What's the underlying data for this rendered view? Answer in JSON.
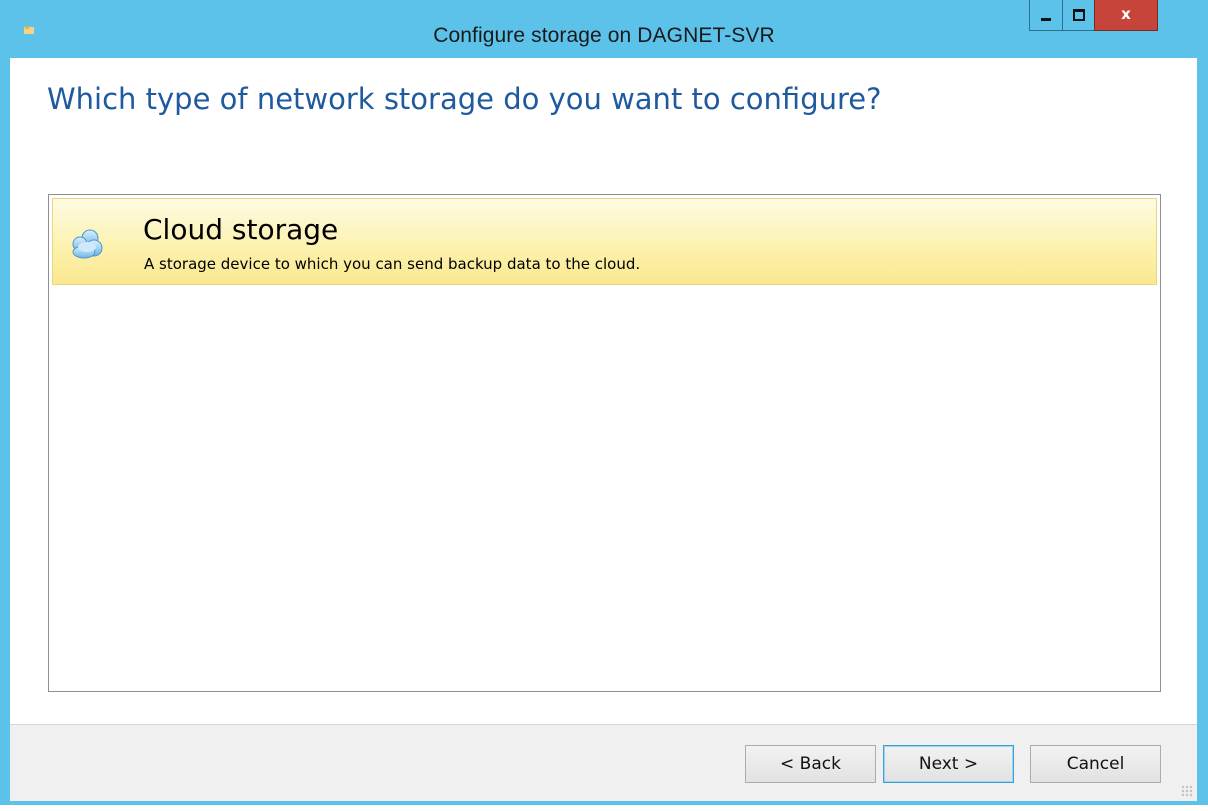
{
  "window": {
    "title": "Configure storage on DAGNET-SVR",
    "icon": "app-icon",
    "caption_buttons": {
      "minimize": "minimize-icon",
      "maximize": "maximize-icon",
      "close": "close-icon"
    },
    "colors": {
      "frame": "#5cc2ea",
      "close": "#c7443a"
    }
  },
  "main": {
    "heading": "Which type of network storage do you want to configure?",
    "heading_color": "#1f5a9e",
    "options": [
      {
        "title": "Cloud storage",
        "description": "A storage device to which you can send backup data to the cloud.",
        "icon": "cloud-icon",
        "selected": true
      }
    ]
  },
  "footer": {
    "back_label": "< Back",
    "next_label": "Next >",
    "cancel_label": "Cancel"
  }
}
